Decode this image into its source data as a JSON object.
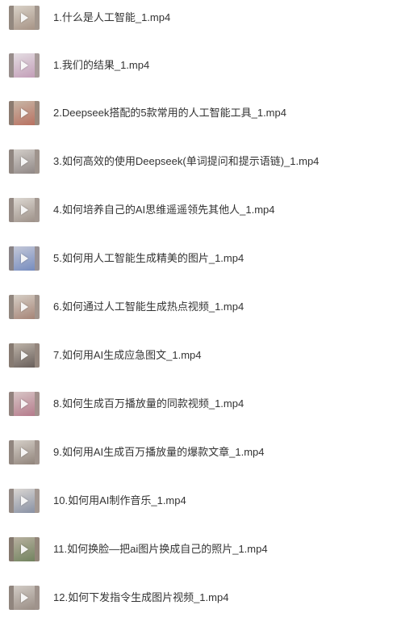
{
  "files": [
    {
      "name": "1.什么是人工智能_1.mp4",
      "icon": "video-thumbnail-icon",
      "thumb_color": "#d9d2c8",
      "accent": "#8a7060"
    },
    {
      "name": "1.我们的结果_1.mp4",
      "icon": "video-thumbnail-icon",
      "thumb_color": "#e4dde2",
      "accent": "#b07aa0"
    },
    {
      "name": "2.Deepseek搭配的5款常用的人工智能工具_1.mp4",
      "icon": "video-thumbnail-icon",
      "thumb_color": "#c7b6a6",
      "accent": "#b04a3a"
    },
    {
      "name": "3.如何高效的使用Deepseek(单词提问和提示语链)_1.mp4",
      "icon": "video-thumbnail-icon",
      "thumb_color": "#d3cec9",
      "accent": "#6a6060"
    },
    {
      "name": "4.如何培养自己的AI思维遥遥领先其他人_1.mp4",
      "icon": "video-thumbnail-icon",
      "thumb_color": "#ddd8d2",
      "accent": "#7a6a60"
    },
    {
      "name": "5.如何用人工智能生成精美的图片_1.mp4",
      "icon": "video-thumbnail-icon",
      "thumb_color": "#c4c8d8",
      "accent": "#4a6ab0"
    },
    {
      "name": "6.如何通过人工智能生成热点视频_1.mp4",
      "icon": "video-thumbnail-icon",
      "thumb_color": "#d6cfc6",
      "accent": "#8a5a4a"
    },
    {
      "name": "7.如何用AI生成应急图文_1.mp4",
      "icon": "video-thumbnail-icon",
      "thumb_color": "#bdb3a8",
      "accent": "#3a3030"
    },
    {
      "name": "8.如何生成百万播放量的同款视频_1.mp4",
      "icon": "video-thumbnail-icon",
      "thumb_color": "#d8c6c6",
      "accent": "#a0506a"
    },
    {
      "name": "9.如何用AI生成百万播放量的爆款文章_1.mp4",
      "icon": "video-thumbnail-icon",
      "thumb_color": "#d5cfc8",
      "accent": "#6a5a50"
    },
    {
      "name": "10.如何用AI制作音乐_1.mp4",
      "icon": "video-thumbnail-icon",
      "thumb_color": "#dad6d2",
      "accent": "#5a6a8a"
    },
    {
      "name": "11.如何换脸—把ai图片换成自己的照片_1.mp4",
      "icon": "video-thumbnail-icon",
      "thumb_color": "#b8b0a0",
      "accent": "#4a6a3a"
    },
    {
      "name": "12.如何下发指令生成图片视频_1.mp4",
      "icon": "video-thumbnail-icon",
      "thumb_color": "#d2ccc6",
      "accent": "#7a6a60"
    }
  ]
}
